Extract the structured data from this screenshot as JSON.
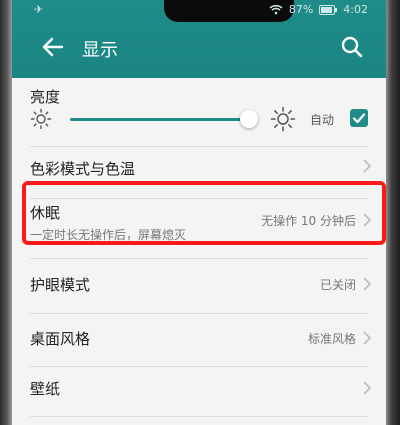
{
  "status": {
    "battery": "87%",
    "time": "4:02"
  },
  "header": {
    "title": "显示"
  },
  "brightness": {
    "label": "亮度",
    "auto_label": "自动",
    "level": 0.95,
    "auto_checked": true
  },
  "settings": [
    {
      "title": "色彩模式与色温",
      "value": ""
    },
    {
      "title": "休眠",
      "subtitle": "一定时长无操作后，屏幕熄灭",
      "value": "无操作 10 分钟后"
    },
    {
      "title": "护眼模式",
      "value": "已关闭"
    },
    {
      "title": "桌面风格",
      "value": "标准风格"
    },
    {
      "title": "壁纸",
      "value": ""
    }
  ],
  "colors": {
    "accent": "#1f8c89",
    "highlight": "#ff1a1a",
    "background": "#f4f4f2"
  },
  "icons": {
    "status_left": "airplane-icon",
    "back": "back-arrow-icon",
    "search": "search-icon",
    "brightness_low": "sun-small-icon",
    "brightness_high": "sun-large-icon",
    "checkbox": "checkmark-icon",
    "chevron": "chevron-right-icon"
  }
}
